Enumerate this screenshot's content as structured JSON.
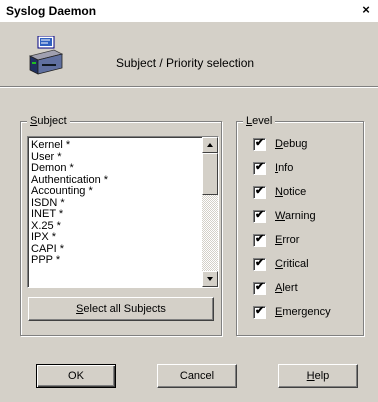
{
  "window": {
    "title": "Syslog Daemon",
    "close_glyph": "×"
  },
  "header": {
    "icon": "computer-network-icon",
    "text": "Subject / Priority selection"
  },
  "subject": {
    "group_label": "Subject",
    "items": [
      "Kernel *",
      "User *",
      "Demon *",
      "Authentication *",
      "Accounting *",
      "ISDN *",
      "INET *",
      "X.25 *",
      "IPX *",
      "CAPI *",
      "PPP *"
    ],
    "select_all_label": "Select all Subjects"
  },
  "level": {
    "group_label": "Level",
    "items": [
      {
        "label": "Debug",
        "checked": true
      },
      {
        "label": "Info",
        "checked": true
      },
      {
        "label": "Notice",
        "checked": true
      },
      {
        "label": "Warning",
        "checked": true
      },
      {
        "label": "Error",
        "checked": true
      },
      {
        "label": "Critical",
        "checked": true
      },
      {
        "label": "Alert",
        "checked": true
      },
      {
        "label": "Emergency",
        "checked": true
      }
    ]
  },
  "buttons": {
    "ok": "OK",
    "cancel": "Cancel",
    "help": "Help"
  },
  "check_glyph": "✔"
}
